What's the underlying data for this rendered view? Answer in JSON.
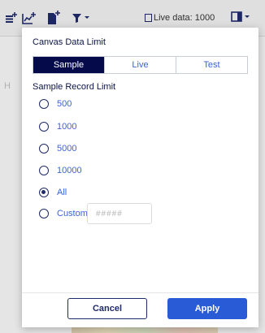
{
  "toolbar": {
    "icons": [
      "table-add-icon",
      "chart-add-icon",
      "document-add-icon",
      "filter-icon",
      "panel-toggle-icon"
    ],
    "live_data_label": "Live data: 1000"
  },
  "background": {
    "hint_letter": "H"
  },
  "dialog": {
    "title": "Canvas Data Limit",
    "tabs": [
      {
        "label": "Sample",
        "active": true
      },
      {
        "label": "Live",
        "active": false
      },
      {
        "label": "Test",
        "active": false
      }
    ],
    "section_label": "Sample Record Limit",
    "options": [
      {
        "label": "500",
        "checked": false
      },
      {
        "label": "1000",
        "checked": false
      },
      {
        "label": "5000",
        "checked": false
      },
      {
        "label": "10000",
        "checked": false
      },
      {
        "label": "All",
        "checked": true
      },
      {
        "label": "Custom",
        "checked": false
      }
    ],
    "custom_placeholder": "#####",
    "cancel_label": "Cancel",
    "apply_label": "Apply"
  },
  "colors": {
    "active_tab": "#040a4a",
    "link_text": "#3a63d8",
    "apply_button": "#2a5bd7",
    "title_text": "#0b1445"
  }
}
